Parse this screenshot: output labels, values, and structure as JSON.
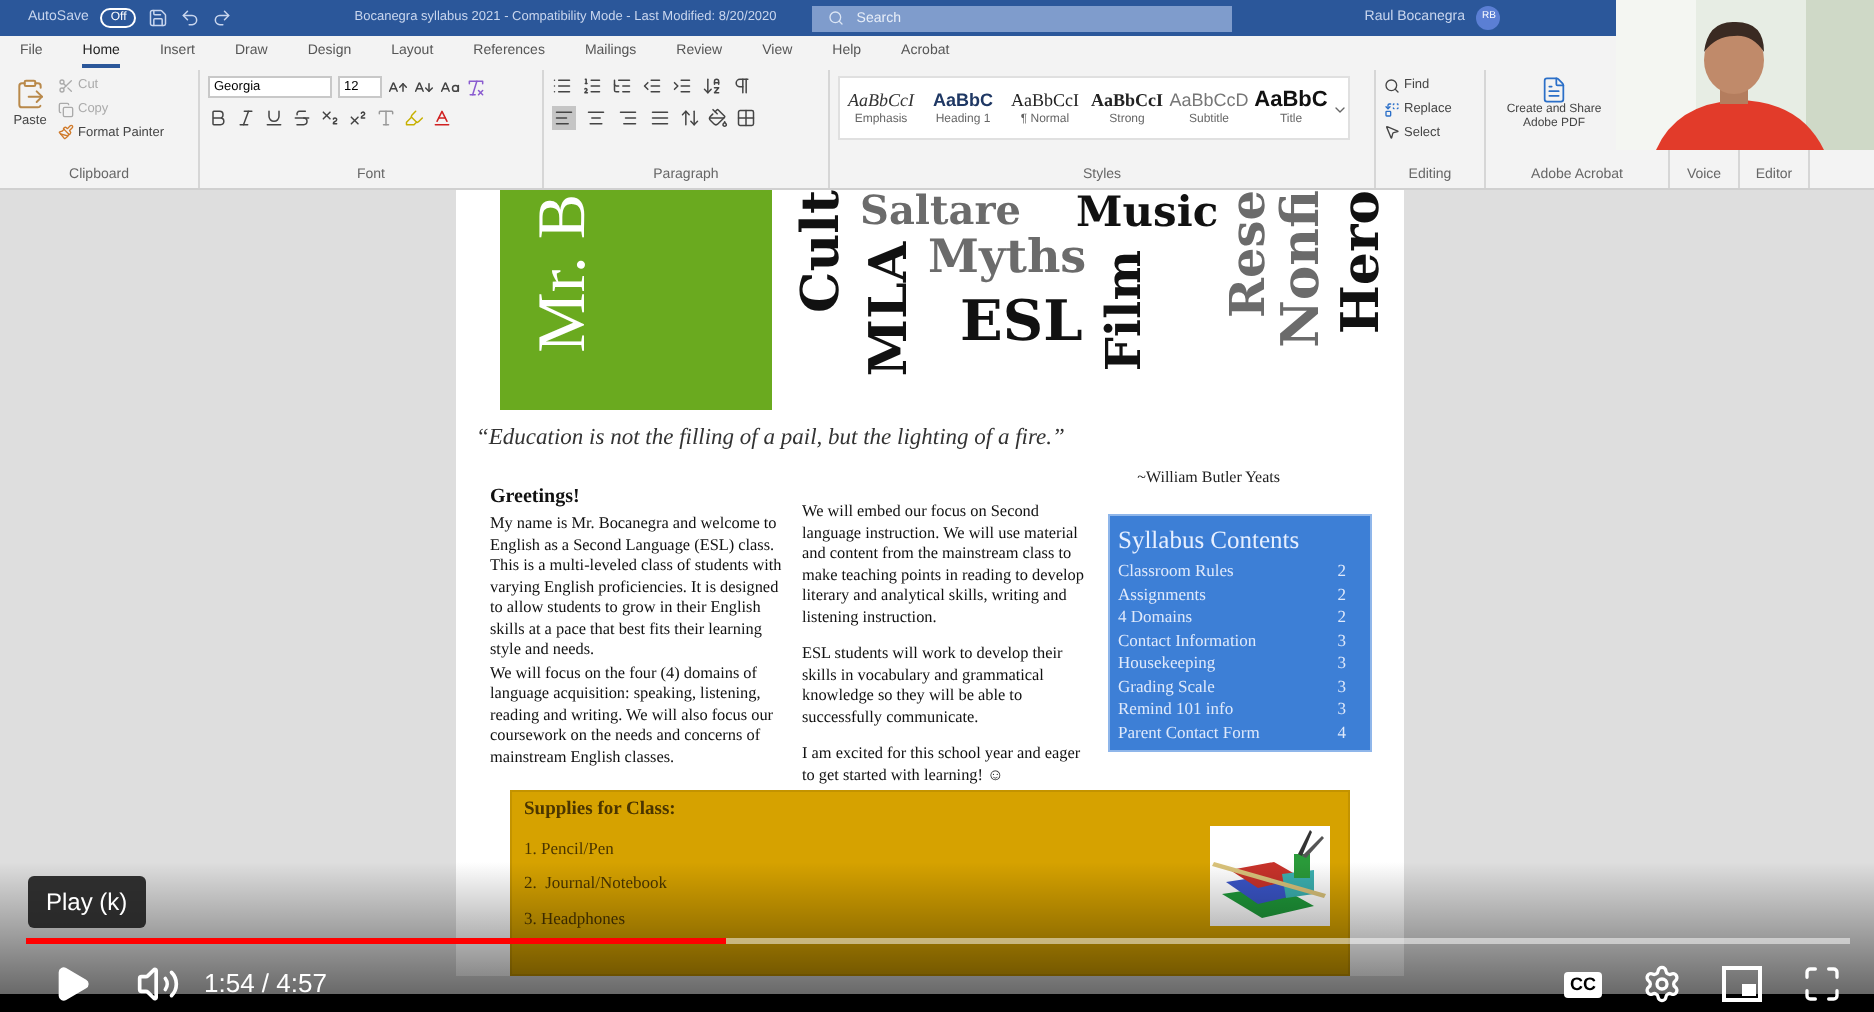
{
  "word": {
    "title_bar": {
      "autosave_label": "AutoSave",
      "autosave_toggle": {
        "label": "Off",
        "on": false
      },
      "document_title": "Bocanegra syllabus 2021  -  Compatibility Mode  -  Last Modified: 8/20/2020",
      "search": {
        "placeholder": "Search"
      },
      "user_name": "Raul Bocanegra",
      "user_initials": "RB"
    },
    "tabs": [
      {
        "label": "File",
        "selected": false
      },
      {
        "label": "Home",
        "selected": true
      },
      {
        "label": "Insert",
        "selected": false
      },
      {
        "label": "Draw",
        "selected": false
      },
      {
        "label": "Design",
        "selected": false
      },
      {
        "label": "Layout",
        "selected": false
      },
      {
        "label": "References",
        "selected": false
      },
      {
        "label": "Mailings",
        "selected": false
      },
      {
        "label": "Review",
        "selected": false
      },
      {
        "label": "View",
        "selected": false
      },
      {
        "label": "Help",
        "selected": false
      },
      {
        "label": "Acrobat",
        "selected": false
      }
    ],
    "ribbon": {
      "clipboard": {
        "paste": "Paste",
        "cut": "Cut",
        "copy": "Copy",
        "format_painter": "Format Painter",
        "label": "Clipboard"
      },
      "font": {
        "family": "Georgia",
        "size": "12",
        "label": "Font"
      },
      "paragraph": {
        "label": "Paragraph",
        "alignments": [
          {
            "kind": "left",
            "selected": true
          },
          {
            "kind": "center",
            "selected": false
          },
          {
            "kind": "right",
            "selected": false
          },
          {
            "kind": "justify",
            "selected": false
          }
        ]
      },
      "styles": {
        "label": "Styles",
        "items": [
          {
            "kind": "emphasis",
            "sample": "AaBbCcI",
            "name": "Emphasis"
          },
          {
            "kind": "heading",
            "sample": "AaBbC",
            "name": "Heading 1"
          },
          {
            "kind": "normal",
            "sample": "AaBbCcI",
            "name": "¶ Normal"
          },
          {
            "kind": "strong",
            "sample": "AaBbCcI",
            "name": "Strong"
          },
          {
            "kind": "subtitle",
            "sample": "AaBbCcD",
            "name": "Subtitle"
          },
          {
            "kind": "title",
            "sample": "AaBbC",
            "name": "Title"
          }
        ]
      },
      "editing": {
        "find": "Find",
        "replace": "Replace",
        "select": "Select",
        "label": "Editing"
      },
      "acrobat": {
        "button": "Create and Share Adobe PDF",
        "label": "Adobe Acrobat"
      },
      "voice": {
        "label": "Voice"
      },
      "editor": {
        "label": "Editor"
      }
    },
    "document": {
      "banner_text": "Mr. B",
      "word_cloud": [
        {
          "text": "Cult",
          "color": "#111111",
          "vertical": true
        },
        {
          "text": "Saltare",
          "color": "#6b6b6b",
          "vertical": false
        },
        {
          "text": "Music",
          "color": "#111111",
          "vertical": false
        },
        {
          "text": "MLA",
          "color": "#111111",
          "vertical": true
        },
        {
          "text": "Myths",
          "color": "#6b6b6b",
          "vertical": false
        },
        {
          "text": "ESL",
          "color": "#111111",
          "vertical": false
        },
        {
          "text": "Film",
          "color": "#111111",
          "vertical": true
        },
        {
          "text": "Rese",
          "color": "#6b6b6b",
          "vertical": true
        },
        {
          "text": "Nonfi",
          "color": "#6b6b6b",
          "vertical": true
        },
        {
          "text": "Hero",
          "color": "#111111",
          "vertical": true
        }
      ],
      "quote": "“Education is not the filling of a pail, but the lighting of a fire.”",
      "attribution": "~William Butler Yeats",
      "greeting": {
        "heading": "Greetings!",
        "paragraphs": [
          "My name is Mr. Bocanegra and welcome to English as a Second Language (ESL) class.  This is a multi-leveled class of students with varying English proficiencies. It is designed to allow students to grow in their English skills at a pace that best fits their learning style and needs.",
          "We will focus on the four (4) domains of language acquisition: speaking, listening, reading and writing.  We will also focus our coursework on the needs and concerns of mainstream English classes."
        ]
      },
      "column_2": {
        "paragraphs": [
          "We will embed our focus on Second language instruction.  We will use material and content from the mainstream class to make teaching points in reading to develop literary and analytical skills, writing and listening instruction.",
          "ESL students will work to develop their skills in vocabulary and grammatical knowledge so they will be able to successfully communicate.",
          "I am excited for this school year and eager to get started with learning! ☺"
        ]
      },
      "syllabus": {
        "title": "Syllabus Contents",
        "rows": [
          {
            "topic": "Classroom Rules",
            "page": "2"
          },
          {
            "topic": "Assignments",
            "page": "2"
          },
          {
            "topic": "4 Domains",
            "page": "2"
          },
          {
            "topic": "Contact Information",
            "page": "3"
          },
          {
            "topic": "Housekeeping",
            "page": "3"
          },
          {
            "topic": "Grading Scale",
            "page": "3"
          },
          {
            "topic": "Remind 101 info",
            "page": "3"
          },
          {
            "topic": "Parent Contact Form",
            "page": "4"
          }
        ]
      },
      "supplies": {
        "title": "Supplies for Class:",
        "items": [
          "1. Pencil/Pen",
          "2.  Journal/Notebook",
          "3. Headphones"
        ]
      }
    }
  },
  "player": {
    "tooltip": "Play (k)",
    "progress": {
      "level": 0.384
    },
    "time": "1:54 / 4:57",
    "captions_label": "CC"
  }
}
